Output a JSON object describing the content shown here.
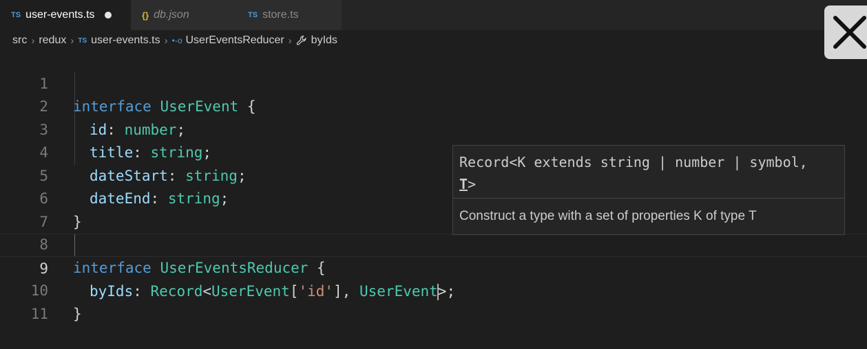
{
  "tabs": [
    {
      "icon": "TS",
      "label": "user-events.ts",
      "dirty": true
    },
    {
      "icon": "{}",
      "label": "db.json"
    },
    {
      "icon": "TS",
      "label": "store.ts"
    }
  ],
  "breadcrumb": {
    "src": "src",
    "redux": "redux",
    "file_icon": "TS",
    "file": "user-events.ts",
    "iface": "UserEventsReducer",
    "prop": "byIds"
  },
  "lines": {
    "l1": {
      "num": "1",
      "t1": "interface",
      "t2": "UserEvent",
      "t3": " {"
    },
    "l2": {
      "num": "2",
      "p": "id",
      "c": ": ",
      "t": "number",
      "e": ";"
    },
    "l3": {
      "num": "3",
      "p": "title",
      "c": ": ",
      "t": "string",
      "e": ";"
    },
    "l4": {
      "num": "4",
      "p": "dateStart",
      "c": ": ",
      "t": "string",
      "e": ";"
    },
    "l5": {
      "num": "5",
      "p": "dateEnd",
      "c": ": ",
      "t": "string",
      "e": ";"
    },
    "l6": {
      "num": "6",
      "text": "}"
    },
    "l7": {
      "num": "7"
    },
    "l8": {
      "num": "8",
      "t1": "interface",
      "t2": "UserEventsReducer",
      "t3": " {"
    },
    "l9": {
      "num": "9",
      "p": "byIds",
      "c": ": ",
      "rec": "Record",
      "lt": "<",
      "ue": "UserEvent",
      "br1": "[",
      "key": "'id'",
      "br2": "], ",
      "ue2": "UserEvent",
      "gt": ">",
      "end": ";"
    },
    "l10": {
      "num": "10",
      "text": "}"
    },
    "l11": {
      "num": "11"
    }
  },
  "hover": {
    "sig1": "Record<K extends string | number | symbol,",
    "sig2_param": "T",
    "sig2_end": ">",
    "doc": "Construct a type with a set of properties K of type T"
  },
  "colors": {
    "keyword": "#569cd6",
    "type": "#4ec9b0",
    "property": "#9cdcfe",
    "string": "#ce9178",
    "editor_bg": "#1e1e1e"
  },
  "icons": {
    "close": "close-icon",
    "wrench": "wrench-icon",
    "interface": "interface-icon"
  }
}
